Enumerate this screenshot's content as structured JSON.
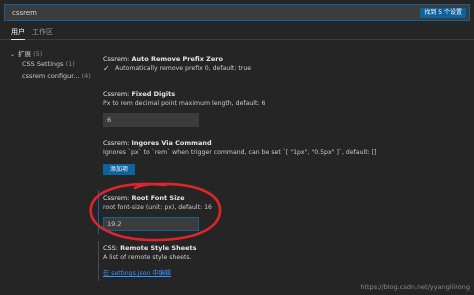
{
  "search": {
    "value": "cssrem",
    "result_badge": "找到 5 个设置"
  },
  "tabs": [
    {
      "label": "用户",
      "active": true
    },
    {
      "label": "工作区",
      "active": false
    }
  ],
  "toc": {
    "group": {
      "label": "扩展",
      "count": "(5)",
      "expanded": true
    },
    "items": [
      {
        "label": "CSS Settings",
        "count": "(1)"
      },
      {
        "label": "cssrem configur...",
        "count": "(4)"
      }
    ]
  },
  "settings": [
    {
      "category": "Cssrem:",
      "name": "Auto Remove Prefix Zero",
      "checkbox_checked": true,
      "checkbox_label": "Automatically remove prefix 0, default: true"
    },
    {
      "category": "Cssrem:",
      "name": "Fixed Digits",
      "description": "Px to rem decimal point maximum length, default: 6",
      "value": "6"
    },
    {
      "category": "Cssrem:",
      "name": "Ingores Via Command",
      "description": "Ignores `px` to `rem` when trigger command, can be set `[ \"1px\", \"0.5px\" ]`, default: []",
      "button_label": "添加项"
    },
    {
      "category": "Cssrem:",
      "name": "Root Font Size",
      "description": "root font-size (unit: px), default: 16",
      "value": "19.2"
    },
    {
      "category": "CSS:",
      "name": "Remote Style Sheets",
      "description": "A list of remote style sheets.",
      "link_label": "在 settings.json 中编辑"
    }
  ],
  "watermark": "https://blog.csdn.net/yyangliirong",
  "colors": {
    "accent": "#0e639c",
    "annotation": "#e0252a",
    "background": "#252526",
    "link": "#3794ff"
  }
}
